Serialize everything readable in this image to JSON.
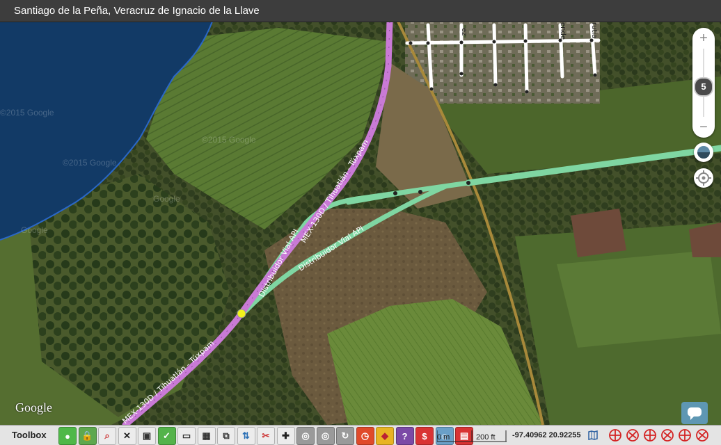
{
  "header": {
    "title": "Santiago de la Peña, Veracruz de Ignacio de la Llave"
  },
  "map": {
    "type": "satellite",
    "watermark": "Google",
    "faint_watermarks": [
      "©2015 Google",
      "©2015 Google",
      "©2015 Google",
      "Google",
      "Google"
    ],
    "road_labels": {
      "highway": "MEX-130D / Tihuatlán - Túxpam",
      "ramp_upper": "Distribuidor Vial API",
      "ramp_mid": "MEX-130D / Tihuatlán - Túxpam",
      "ramp_lower": "Distribuidor Vial API"
    },
    "street_fragments": [
      "ez",
      "ende",
      "rutia"
    ],
    "colors": {
      "water": "#123a66",
      "highway": "#c97ad6",
      "ramp": "#7fd6a2",
      "rail": "#a8893a",
      "street": "#ffffff",
      "selected_node": "#f2f21c"
    }
  },
  "zoom": {
    "plus": "+",
    "minus": "−",
    "level": "5"
  },
  "controls": {
    "layers_icon": "layers-toggle",
    "locate_icon": "crosshair"
  },
  "toolbar": {
    "label": "Toolbox",
    "icons": [
      {
        "name": "gps-icon",
        "bg": "#4fb848",
        "glyph": "●",
        "color": "#fff"
      },
      {
        "name": "lock-icon",
        "bg": "#5ea84e",
        "glyph": "🔒",
        "color": "#fff"
      },
      {
        "name": "search-road-icon",
        "bg": "#ececec",
        "glyph": "⌕",
        "color": "#c33"
      },
      {
        "name": "tools-icon",
        "bg": "#ececec",
        "glyph": "✕",
        "color": "#222"
      },
      {
        "name": "select-area-icon",
        "bg": "#ececec",
        "glyph": "▣",
        "color": "#333"
      },
      {
        "name": "validate-icon",
        "bg": "#54b34a",
        "glyph": "✓",
        "color": "#fff"
      },
      {
        "name": "ruler-icon",
        "bg": "#ececec",
        "glyph": "▭",
        "color": "#333"
      },
      {
        "name": "calendar-icon",
        "bg": "#ececec",
        "glyph": "▦",
        "color": "#333"
      },
      {
        "name": "copy-icon",
        "bg": "#ececec",
        "glyph": "⧉",
        "color": "#333"
      },
      {
        "name": "arrows-icon",
        "bg": "#ececec",
        "glyph": "⇅",
        "color": "#2a6fb5"
      },
      {
        "name": "cut-icon",
        "bg": "#ececec",
        "glyph": "✂",
        "color": "#c33"
      },
      {
        "name": "junction-icon",
        "bg": "#ececec",
        "glyph": "✚",
        "color": "#222"
      },
      {
        "name": "roundabout-icon",
        "bg": "#9a9a9a",
        "glyph": "◎",
        "color": "#fff"
      },
      {
        "name": "roundabout2-icon",
        "bg": "#9a9a9a",
        "glyph": "◎",
        "color": "#fff"
      },
      {
        "name": "rotate-icon",
        "bg": "#9a9a9a",
        "glyph": "↻",
        "color": "#fff"
      },
      {
        "name": "clock-icon",
        "bg": "#e04a2a",
        "glyph": "◷",
        "color": "#fff"
      },
      {
        "name": "direction-icon",
        "bg": "#e8b423",
        "glyph": "◆",
        "color": "#b23"
      },
      {
        "name": "help-icon",
        "bg": "#7b4aa6",
        "glyph": "?",
        "color": "#fff"
      },
      {
        "name": "toll-icon",
        "bg": "#d93434",
        "glyph": "$",
        "color": "#fff"
      },
      {
        "name": "user-icon",
        "bg": "#6aa0c8",
        "glyph": "☺",
        "color": "#fff"
      },
      {
        "name": "sign-icon",
        "bg": "#d93434",
        "glyph": "▤",
        "color": "#fff"
      }
    ],
    "scale_metric": "0 m",
    "scale_imperial": "200 ft",
    "coordinates": "-97.40962 20.92255",
    "right_icons": [
      "connector-a-icon",
      "connector-b-icon",
      "connector-c-icon",
      "connector-d-icon",
      "connector-e-icon",
      "connector-f-icon"
    ]
  }
}
